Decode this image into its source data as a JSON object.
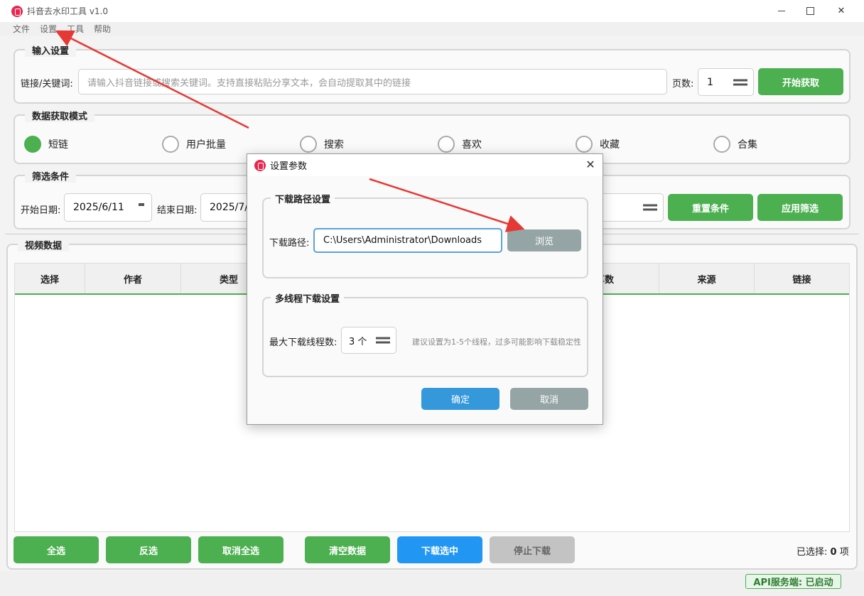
{
  "window": {
    "title": "抖音去水印工具 v1.0",
    "close_glyph": "✕"
  },
  "menu": [
    "文件",
    "设置",
    "工具",
    "帮助"
  ],
  "input_section": {
    "title": "输入设置",
    "link_label": "链接/关键词:",
    "link_placeholder": "请输入抖音链接或搜索关键词。支持直接粘贴分享文本，会自动提取其中的链接",
    "pages_label": "页数:",
    "pages_value": "1",
    "start_button": "开始获取"
  },
  "mode_section": {
    "title": "数据获取模式",
    "options": [
      "短链",
      "用户批量",
      "搜索",
      "喜欢",
      "收藏",
      "合集"
    ],
    "selected": "短链"
  },
  "filter_section": {
    "title": "筛选条件",
    "start_label": "开始日期:",
    "start_value": "2025/6/11",
    "end_label": "结束日期:",
    "end_value": "2025/7/",
    "reset_button": "重置条件",
    "apply_button": "应用筛选"
  },
  "video_section": {
    "title": "视频数据",
    "columns": [
      "选择",
      "作者",
      "类型",
      "分享数",
      "来源",
      "链接"
    ]
  },
  "bottom_buttons": {
    "select_all": "全选",
    "invert": "反选",
    "deselect_all": "取消全选",
    "clear": "清空数据",
    "download_selected": "下载选中",
    "stop_download": "停止下载"
  },
  "selected_text": {
    "label": "已选择:",
    "count": "0",
    "unit": "项"
  },
  "api_status": "API服务端: 已启动",
  "dialog": {
    "title": "设置参数",
    "close_glyph": "✕",
    "path_group_title": "下载路径设置",
    "path_label": "下载路径:",
    "path_value": "C:\\Users\\Administrator\\Downloads",
    "browse_button": "浏览",
    "thread_group_title": "多线程下载设置",
    "thread_label": "最大下载线程数:",
    "thread_value": "3 个",
    "thread_hint": "建议设置为1-5个线程，过多可能影响下载稳定性",
    "ok_button": "确定",
    "cancel_button": "取消"
  },
  "colors": {
    "accent_green": "#4caf50",
    "accent_blue": "#2196f3",
    "arrow_red": "#e53935"
  }
}
